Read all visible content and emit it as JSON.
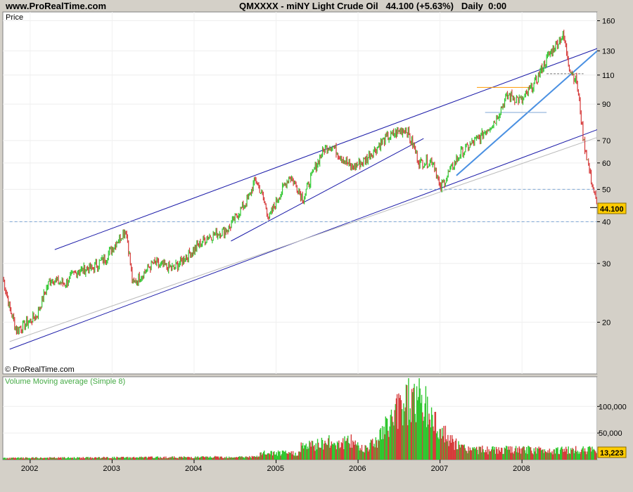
{
  "header": {
    "site": "www.ProRealTime.com",
    "instrument": "QMXXXX - miNY Light Crude Oil",
    "last": "44.100 (+5.63%)",
    "period": "Daily  0:00"
  },
  "price_panel": {
    "label": "Price",
    "copyright": "© ProRealTime.com",
    "last_price_badge": "44.100",
    "badge_color": "#ffcc00"
  },
  "volume_panel": {
    "label": "Volume Moving average (Simple 8)",
    "last_volume_badge": "13,223",
    "label_color": "#44aa44"
  },
  "colors": {
    "up": "#2ec72e",
    "down": "#d63a3a",
    "channel": "#1a1aa8",
    "trend": "#4a90e2",
    "support": "#7fa7d4"
  },
  "chart_data": [
    {
      "type": "candlestick",
      "title": "QMXXXX - miNY Light Crude Oil",
      "ylabel": "Price",
      "yscale": "log",
      "ylim": [
        14,
        170
      ],
      "xlim": [
        "2001-09",
        "2008-12"
      ],
      "x_ticks": [
        "2002",
        "2003",
        "2004",
        "2005",
        "2006",
        "2007",
        "2008"
      ],
      "y_ticks": [
        20,
        30,
        40,
        50,
        60,
        70,
        90,
        110,
        130,
        160
      ],
      "last_close": 44.1,
      "last_change_pct": 5.63,
      "approx_monthly_close": [
        [
          "2001-09",
          27
        ],
        [
          "2001-10",
          22
        ],
        [
          "2001-11",
          19
        ],
        [
          "2001-12",
          19.5
        ],
        [
          "2002-02",
          21
        ],
        [
          "2002-04",
          27
        ],
        [
          "2002-06",
          26
        ],
        [
          "2002-08",
          28.5
        ],
        [
          "2002-10",
          29
        ],
        [
          "2002-12",
          31
        ],
        [
          "2003-03",
          38
        ],
        [
          "2003-04",
          26
        ],
        [
          "2003-07",
          30
        ],
        [
          "2003-10",
          29
        ],
        [
          "2004-01",
          33
        ],
        [
          "2004-03",
          36
        ],
        [
          "2004-06",
          38
        ],
        [
          "2004-09",
          47
        ],
        [
          "2004-10",
          54
        ],
        [
          "2004-12",
          41
        ],
        [
          "2005-03",
          55
        ],
        [
          "2005-05",
          47
        ],
        [
          "2005-08",
          66
        ],
        [
          "2005-09",
          68
        ],
        [
          "2005-12",
          58
        ],
        [
          "2006-02",
          61
        ],
        [
          "2006-05",
          71
        ],
        [
          "2006-08",
          76
        ],
        [
          "2006-10",
          60
        ],
        [
          "2006-12",
          61
        ],
        [
          "2007-01",
          50
        ],
        [
          "2007-04",
          64
        ],
        [
          "2007-07",
          72
        ],
        [
          "2007-09",
          80
        ],
        [
          "2007-11",
          96
        ],
        [
          "2008-01",
          92
        ],
        [
          "2008-03",
          105
        ],
        [
          "2008-05",
          127
        ],
        [
          "2008-07",
          145
        ],
        [
          "2008-08",
          115
        ],
        [
          "2008-09",
          105
        ],
        [
          "2008-10",
          70
        ],
        [
          "2008-11",
          55
        ],
        [
          "2008-12",
          44.1
        ]
      ],
      "annotations": [
        "upper channel line",
        "lower channel line",
        "inner trendlines",
        "horizontal support 50",
        "horizontal support 40"
      ]
    },
    {
      "type": "bar",
      "title": "Volume Moving average (Simple 8)",
      "y_ticks": [
        50000,
        100000
      ],
      "y_tick_labels": [
        "50,000",
        "100,000"
      ],
      "last_value": 13223,
      "peak_value": 130000,
      "peak_date": "2006-09"
    }
  ]
}
